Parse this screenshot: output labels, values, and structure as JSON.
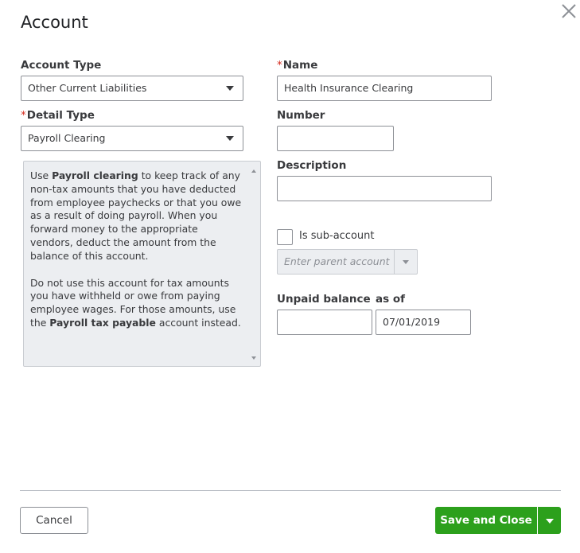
{
  "dialog": {
    "title": "Account",
    "close_icon": "close-icon"
  },
  "form": {
    "account_type": {
      "label": "Account Type",
      "value": "Other Current Liabilities"
    },
    "detail_type": {
      "required_mark": "*",
      "label": "Detail Type",
      "value": "Payroll Clearing"
    },
    "name": {
      "required_mark": "*",
      "label": "Name",
      "value": "Health Insurance Clearing"
    },
    "number": {
      "label": "Number",
      "value": ""
    },
    "description": {
      "label": "Description",
      "value": ""
    },
    "sub_account": {
      "label": "Is sub-account",
      "checked": false,
      "parent_placeholder": "Enter parent account"
    },
    "unpaid_balance": {
      "label": "Unpaid balance",
      "value": ""
    },
    "as_of": {
      "label": "as of",
      "value": "07/01/2019"
    }
  },
  "help": {
    "p1_use": "Use ",
    "p1_bold": "Payroll clearing",
    "p1_rest": " to keep track of any non-tax amounts that you have deducted from employee paychecks or that you owe as a result of doing payroll. When you forward money to the appropriate vendors, deduct the amount from the balance of this account.",
    "p2_start": "Do not use this account for tax amounts you have withheld or owe from paying employee wages. For those amounts, use the ",
    "p2_bold": "Payroll tax payable",
    "p2_end": " account instead."
  },
  "footer": {
    "cancel_label": "Cancel",
    "save_label": "Save and Close"
  },
  "colors": {
    "primary_button": "#2ca01c",
    "required_asterisk": "#d52b1e",
    "help_background": "#eceef1"
  }
}
